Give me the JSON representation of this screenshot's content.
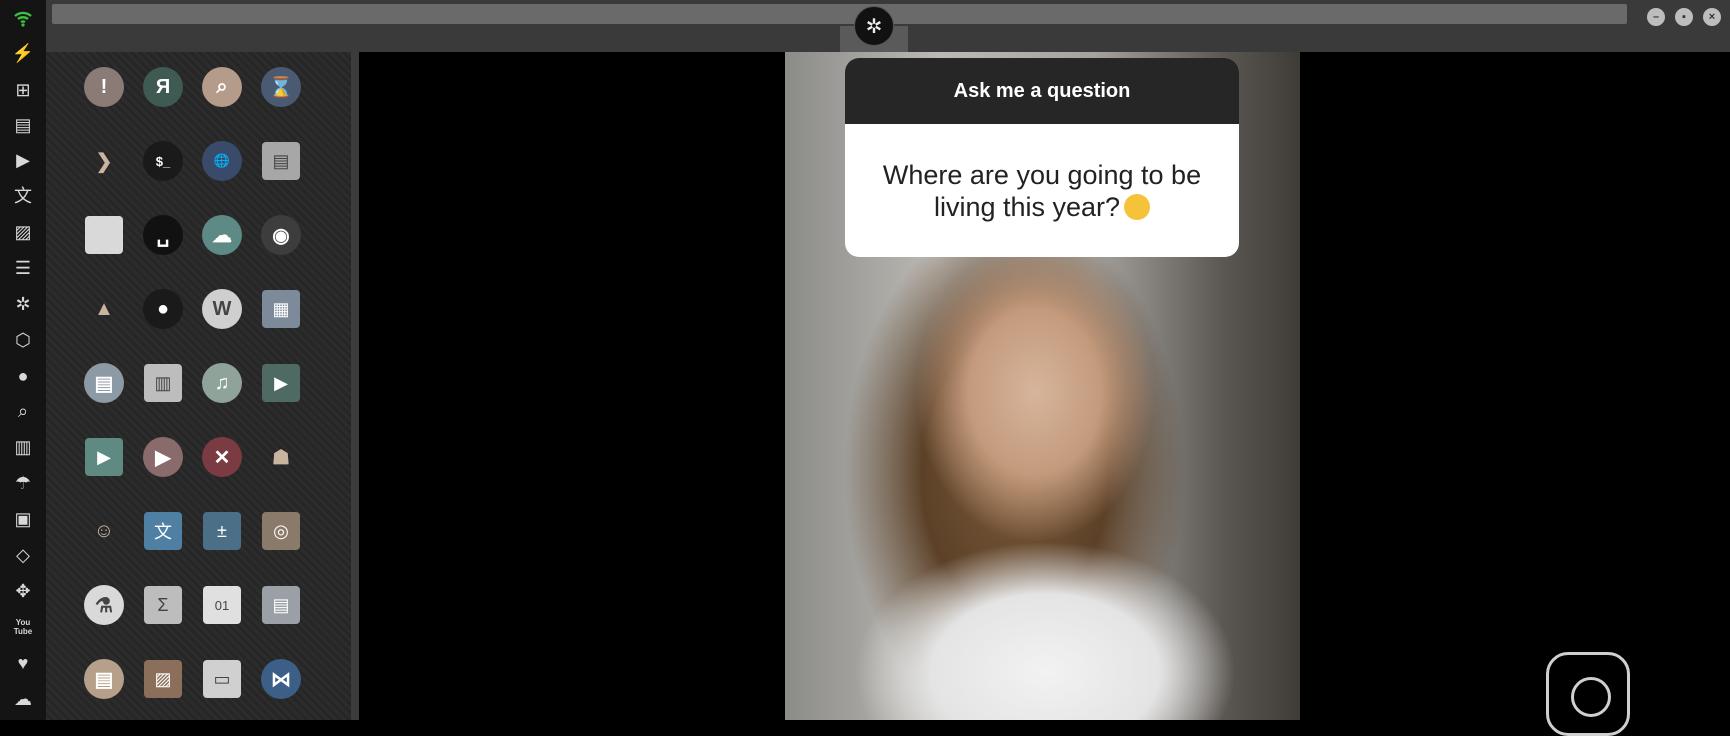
{
  "window": {
    "minimize_symbol": "–",
    "maximize_symbol": "▪",
    "close_symbol": "×"
  },
  "sidebar": {
    "items": [
      {
        "name": "wifi-icon",
        "glyph": "wifi"
      },
      {
        "name": "lightning-icon",
        "glyph": "⚡"
      },
      {
        "name": "windows-icon",
        "glyph": "⊞"
      },
      {
        "name": "archive-icon",
        "glyph": "▤"
      },
      {
        "name": "play-circle-icon",
        "glyph": "▶"
      },
      {
        "name": "translate-icon",
        "glyph": "文"
      },
      {
        "name": "image-icon",
        "glyph": "▨"
      },
      {
        "name": "news-icon",
        "glyph": "☰"
      },
      {
        "name": "rebel-icon",
        "glyph": "✲"
      },
      {
        "name": "hexagon-icon",
        "glyph": "⬡"
      },
      {
        "name": "globe-icon",
        "glyph": "●"
      },
      {
        "name": "search-icon",
        "glyph": "⌕"
      },
      {
        "name": "map-icon",
        "glyph": "▥"
      },
      {
        "name": "umbrella-icon",
        "glyph": "☂"
      },
      {
        "name": "contacts-icon",
        "glyph": "▣"
      },
      {
        "name": "code-icon",
        "glyph": "◇"
      },
      {
        "name": "expand-icon",
        "glyph": "✥"
      },
      {
        "name": "youtube-icon",
        "glyph": "You\nTube"
      },
      {
        "name": "heart-icon",
        "glyph": "♥"
      },
      {
        "name": "cloud-icon",
        "glyph": "☁"
      }
    ]
  },
  "launcher": {
    "apps": [
      {
        "name": "warning-app-icon",
        "glyph": "!",
        "bg": "#8a7b77",
        "shape": "circle"
      },
      {
        "name": "yandex-app-icon",
        "glyph": "Я",
        "bg": "#3f5a52",
        "shape": "circle"
      },
      {
        "name": "search-app-icon",
        "glyph": "⌕",
        "bg": "#b59b8a",
        "shape": "circle"
      },
      {
        "name": "hourglass-app-icon",
        "glyph": "⌛",
        "bg": "#4a5a73",
        "shape": "circle"
      },
      {
        "name": "chevron-app-icon",
        "glyph": "❯",
        "bg": "transparent",
        "shape": "circle"
      },
      {
        "name": "terminal-app-icon",
        "glyph": "$_",
        "bg": "#1a1a1a",
        "shape": "circle"
      },
      {
        "name": "globe-app-icon",
        "glyph": "🌐",
        "bg": "#3a4a6a",
        "shape": "circle"
      },
      {
        "name": "drive-app-icon",
        "glyph": "▤",
        "bg": "#a7a7a7",
        "shape": "square"
      },
      {
        "name": "window-app-icon",
        "glyph": "",
        "bg": "#d9d9d9",
        "shape": "square"
      },
      {
        "name": "keyboard-app-icon",
        "glyph": "␣",
        "bg": "#111111",
        "shape": "circle"
      },
      {
        "name": "cloud-lock-app-icon",
        "glyph": "☁",
        "bg": "#5d8a84",
        "shape": "circle"
      },
      {
        "name": "github-app-icon",
        "glyph": "◉",
        "bg": "#3d3d3d",
        "shape": "circle"
      },
      {
        "name": "starfleet-app-icon",
        "glyph": "▲",
        "bg": "transparent",
        "shape": "circle"
      },
      {
        "name": "death-star-app-icon",
        "glyph": "●",
        "bg": "#1a1a1a",
        "shape": "circle"
      },
      {
        "name": "wikipedia-app-icon",
        "glyph": "W",
        "bg": "#cfcfcf",
        "shape": "circle"
      },
      {
        "name": "world-map-app-icon",
        "glyph": "▦",
        "bg": "#7d8a9a",
        "shape": "square"
      },
      {
        "name": "files-app-icon",
        "glyph": "▤",
        "bg": "#8c9aa6",
        "shape": "circle"
      },
      {
        "name": "notebook-app-icon",
        "glyph": "▥",
        "bg": "#bdbdbd",
        "shape": "square"
      },
      {
        "name": "music-app-icon",
        "glyph": "♫",
        "bg": "#8fa39a",
        "shape": "circle"
      },
      {
        "name": "video-app-icon",
        "glyph": "▶",
        "bg": "#4f6a63",
        "shape": "square"
      },
      {
        "name": "player-app-icon",
        "glyph": "▶",
        "bg": "#5e8a82",
        "shape": "square"
      },
      {
        "name": "media-app-icon",
        "glyph": "▶",
        "bg": "#8a6b6b",
        "shape": "circle"
      },
      {
        "name": "close-app-icon",
        "glyph": "✕",
        "bg": "#7a3b42",
        "shape": "circle"
      },
      {
        "name": "droid-app-icon",
        "glyph": "☗",
        "bg": "transparent",
        "shape": "circle"
      },
      {
        "name": "c3po-app-icon",
        "glyph": "☺",
        "bg": "transparent",
        "shape": "circle"
      },
      {
        "name": "translator-app-icon",
        "glyph": "文",
        "bg": "#4f7fa3",
        "shape": "square"
      },
      {
        "name": "calculator-app-icon",
        "glyph": "±",
        "bg": "#4a6f86",
        "shape": "square"
      },
      {
        "name": "camera-app-icon",
        "glyph": "◎",
        "bg": "#8a7a6a",
        "shape": "square"
      },
      {
        "name": "lab-app-icon",
        "glyph": "⚗",
        "bg": "#d9d9d9",
        "shape": "circle"
      },
      {
        "name": "sigma-app-icon",
        "glyph": "Σ",
        "bg": "#bdbdbd",
        "shape": "square"
      },
      {
        "name": "binary-app-icon",
        "glyph": "01",
        "bg": "#e0e0e0",
        "shape": "square"
      },
      {
        "name": "spreadsheet-app-icon",
        "glyph": "▤",
        "bg": "#9aa0a6",
        "shape": "square"
      },
      {
        "name": "document-app-icon",
        "glyph": "▤",
        "bg": "#b7a08a",
        "shape": "circle"
      },
      {
        "name": "picture-app-icon",
        "glyph": "▨",
        "bg": "#8b6f5a",
        "shape": "square"
      },
      {
        "name": "presentation-app-icon",
        "glyph": "▭",
        "bg": "#d0d0d0",
        "shape": "square"
      },
      {
        "name": "vscode-app-icon",
        "glyph": "⋈",
        "bg": "#3b5f86",
        "shape": "circle"
      }
    ]
  },
  "story": {
    "header": "Ask me a question",
    "question": "Where are you going to be living this year?"
  }
}
